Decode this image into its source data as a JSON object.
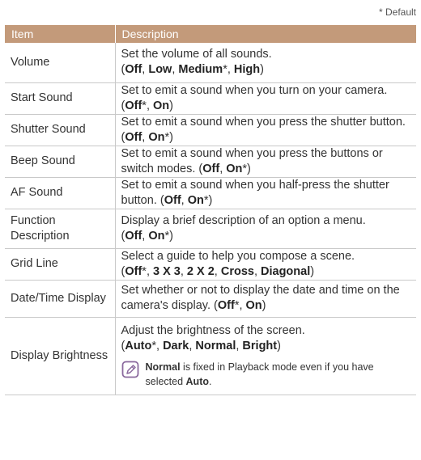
{
  "default_note": "* Default",
  "header": {
    "item": "Item",
    "description": "Description"
  },
  "rows": [
    {
      "item": "Volume",
      "desc": "Set the volume of all sounds.",
      "options": [
        {
          "label": "Off",
          "default": false
        },
        {
          "label": "Low",
          "default": false
        },
        {
          "label": "Medium",
          "default": true
        },
        {
          "label": "High",
          "default": false
        }
      ],
      "options_newline": true
    },
    {
      "item": "Start Sound",
      "desc": "Set to emit a sound when you turn on your camera.",
      "options": [
        {
          "label": "Off",
          "default": true
        },
        {
          "label": "On",
          "default": false
        }
      ]
    },
    {
      "item": "Shutter Sound",
      "desc": "Set to emit a sound when you press the shutter button.",
      "options": [
        {
          "label": "Off",
          "default": false
        },
        {
          "label": "On",
          "default": true
        }
      ]
    },
    {
      "item": "Beep Sound",
      "desc": "Set to emit a sound when you press the buttons or switch modes.",
      "options": [
        {
          "label": "Off",
          "default": false
        },
        {
          "label": "On",
          "default": true
        }
      ]
    },
    {
      "item": "AF Sound",
      "desc": "Set to emit a sound when you half-press the shutter button.",
      "options": [
        {
          "label": "Off",
          "default": false
        },
        {
          "label": "On",
          "default": true
        }
      ]
    },
    {
      "item": "Function Description",
      "desc": "Display a brief description of an option a menu.",
      "options": [
        {
          "label": "Off",
          "default": false
        },
        {
          "label": "On",
          "default": true
        }
      ],
      "options_newline": true
    },
    {
      "item": "Grid Line",
      "desc": "Select a guide to help you compose a scene.",
      "options": [
        {
          "label": "Off",
          "default": true
        },
        {
          "label": "3 X 3",
          "default": false
        },
        {
          "label": "2 X 2",
          "default": false
        },
        {
          "label": "Cross",
          "default": false
        },
        {
          "label": "Diagonal",
          "default": false
        }
      ],
      "options_newline": true
    },
    {
      "item": "Date/Time Display",
      "desc": "Set whether or not to display the date and time on the camera's display.",
      "options": [
        {
          "label": "Off",
          "default": true
        },
        {
          "label": "On",
          "default": false
        }
      ]
    },
    {
      "item": "Display Brightness",
      "desc": "Adjust the brightness of the screen.",
      "options": [
        {
          "label": "Auto",
          "default": true
        },
        {
          "label": "Dark",
          "default": false
        },
        {
          "label": "Normal",
          "default": false
        },
        {
          "label": "Bright",
          "default": false
        }
      ],
      "options_newline": true,
      "note": {
        "icon": "note-pencil-icon",
        "bold_start": "Normal",
        "middle": " is fixed in Playback mode even if you have selected ",
        "bold_end": "Auto",
        "end": "."
      }
    }
  ],
  "colors": {
    "header_bg": "#c39a7a",
    "rule": "#c9c9c9",
    "icon": "#8b6a9e"
  }
}
